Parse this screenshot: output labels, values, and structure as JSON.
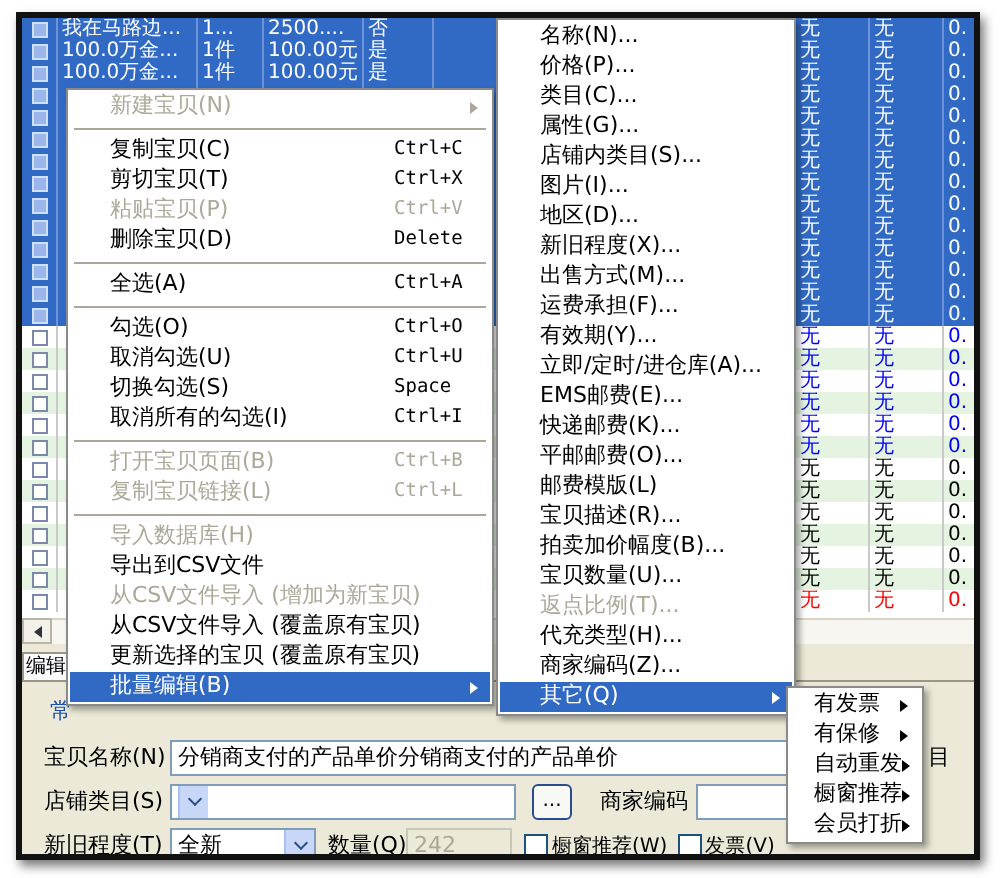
{
  "table": {
    "rows": [
      {
        "selected": true,
        "cells": [
          "我在马路边...",
          "1...",
          "2500....",
          "否"
        ],
        "end_cells": [
          "无",
          "无",
          "0."
        ]
      },
      {
        "selected": true,
        "cells": [
          "100.0万金...",
          "1件",
          "100.00元",
          "是"
        ],
        "end_cells": [
          "无",
          "无",
          "0."
        ]
      },
      {
        "selected": true,
        "cells": [
          "100.0万金...",
          "1件",
          "100.00元",
          "是"
        ],
        "end_cells": [
          "无",
          "无",
          "0."
        ]
      },
      {
        "selected": true,
        "end_cells": [
          "无",
          "无",
          "0."
        ]
      },
      {
        "selected": true,
        "end_cells": [
          "无",
          "无",
          "0."
        ]
      },
      {
        "selected": true,
        "end_cells": [
          "无",
          "无",
          "0."
        ]
      },
      {
        "selected": true,
        "end_cells": [
          "无",
          "无",
          "0."
        ]
      },
      {
        "selected": true,
        "end_cells": [
          "无",
          "无",
          "0."
        ]
      },
      {
        "selected": true,
        "end_cells": [
          "无",
          "无",
          "0."
        ]
      },
      {
        "selected": true,
        "end_cells": [
          "无",
          "无",
          "0."
        ]
      },
      {
        "selected": true,
        "end_cells": [
          "无",
          "无",
          "0."
        ]
      },
      {
        "selected": true,
        "end_cells": [
          "无",
          "无",
          "0."
        ]
      },
      {
        "selected": true,
        "end_cells": [
          "无",
          "无",
          "0."
        ]
      },
      {
        "selected": true,
        "end_cells": [
          "无",
          "无",
          "0."
        ]
      },
      {
        "selected": false,
        "color": "#0000ff",
        "end_cells": [
          "无",
          "无",
          "0."
        ]
      },
      {
        "selected": false,
        "color": "#0000ff",
        "end_cells": [
          "无",
          "无",
          "0."
        ]
      },
      {
        "selected": false,
        "color": "#0000ff",
        "end_cells": [
          "无",
          "无",
          "0."
        ]
      },
      {
        "selected": false,
        "color": "#0000ff",
        "end_cells": [
          "无",
          "无",
          "0."
        ]
      },
      {
        "selected": false,
        "color": "#0000ff",
        "end_cells": [
          "无",
          "无",
          "0."
        ]
      },
      {
        "selected": false,
        "color": "#0000ff",
        "end_cells": [
          "无",
          "无",
          "0."
        ]
      },
      {
        "selected": false,
        "color": "#000000",
        "end_cells": [
          "无",
          "无",
          "0."
        ]
      },
      {
        "selected": false,
        "color": "#000000",
        "end_cells": [
          "无",
          "无",
          "0."
        ]
      },
      {
        "selected": false,
        "color": "#000000",
        "end_cells": [
          "无",
          "无",
          "0."
        ]
      },
      {
        "selected": false,
        "color": "#000000",
        "end_cells": [
          "无",
          "无",
          "0."
        ]
      },
      {
        "selected": false,
        "color": "#000000",
        "end_cells": [
          "无",
          "无",
          "0."
        ]
      },
      {
        "selected": false,
        "color": "#000000",
        "end_cells": [
          "无",
          "无",
          "0."
        ]
      },
      {
        "selected": false,
        "color": "#ff0000",
        "end_cells": [
          "无",
          "无",
          "0."
        ]
      }
    ]
  },
  "context_menu": {
    "items": [
      {
        "kind": "item",
        "label": "新建宝贝(N)",
        "disabled": true,
        "has_submenu": true,
        "selected": false
      },
      {
        "kind": "separator"
      },
      {
        "kind": "item",
        "label": "复制宝贝(C)",
        "shortcut": "Ctrl+C",
        "disabled": false,
        "has_submenu": false,
        "selected": false
      },
      {
        "kind": "item",
        "label": "剪切宝贝(T)",
        "shortcut": "Ctrl+X",
        "disabled": false,
        "has_submenu": false,
        "selected": false
      },
      {
        "kind": "item",
        "label": "粘贴宝贝(P)",
        "shortcut": "Ctrl+V",
        "disabled": true,
        "has_submenu": false,
        "selected": false
      },
      {
        "kind": "item",
        "label": "删除宝贝(D)",
        "shortcut": "Delete",
        "disabled": false,
        "has_submenu": false,
        "selected": false
      },
      {
        "kind": "separator"
      },
      {
        "kind": "item",
        "label": "全选(A)",
        "shortcut": "Ctrl+A",
        "disabled": false,
        "has_submenu": false,
        "selected": false
      },
      {
        "kind": "separator"
      },
      {
        "kind": "item",
        "label": "勾选(O)",
        "shortcut": "Ctrl+O",
        "disabled": false,
        "has_submenu": false,
        "selected": false
      },
      {
        "kind": "item",
        "label": "取消勾选(U)",
        "shortcut": "Ctrl+U",
        "disabled": false,
        "has_submenu": false,
        "selected": false
      },
      {
        "kind": "item",
        "label": "切换勾选(S)",
        "shortcut": "Space",
        "disabled": false,
        "has_submenu": false,
        "selected": false
      },
      {
        "kind": "item",
        "label": "取消所有的勾选(I)",
        "shortcut": "Ctrl+I",
        "disabled": false,
        "has_submenu": false,
        "selected": false
      },
      {
        "kind": "separator"
      },
      {
        "kind": "item",
        "label": "打开宝贝页面(B)",
        "shortcut": "Ctrl+B",
        "disabled": true,
        "has_submenu": false,
        "selected": false
      },
      {
        "kind": "item",
        "label": "复制宝贝链接(L)",
        "shortcut": "Ctrl+L",
        "disabled": true,
        "has_submenu": false,
        "selected": false
      },
      {
        "kind": "separator"
      },
      {
        "kind": "item",
        "label": "导入数据库(H)",
        "disabled": true,
        "has_submenu": false,
        "selected": false
      },
      {
        "kind": "item",
        "label": "导出到CSV文件",
        "disabled": false,
        "has_submenu": false,
        "selected": false
      },
      {
        "kind": "item",
        "label": "从CSV文件导入 (增加为新宝贝)",
        "disabled": true,
        "has_submenu": false,
        "selected": false
      },
      {
        "kind": "item",
        "label": "从CSV文件导入 (覆盖原有宝贝)",
        "disabled": false,
        "has_submenu": false,
        "selected": false
      },
      {
        "kind": "item",
        "label": "更新选择的宝贝 (覆盖原有宝贝)",
        "disabled": false,
        "has_submenu": false,
        "selected": false
      },
      {
        "kind": "item",
        "label": "批量编辑(B)",
        "disabled": false,
        "has_submenu": true,
        "selected": true
      }
    ]
  },
  "batch_edit_menu": {
    "items": [
      {
        "kind": "item",
        "label": "名称(N)...",
        "disabled": false,
        "has_submenu": false,
        "selected": false
      },
      {
        "kind": "item",
        "label": "价格(P)...",
        "disabled": false,
        "has_submenu": false,
        "selected": false
      },
      {
        "kind": "item",
        "label": "类目(C)...",
        "disabled": false,
        "has_submenu": false,
        "selected": false
      },
      {
        "kind": "item",
        "label": "属性(G)...",
        "disabled": false,
        "has_submenu": false,
        "selected": false
      },
      {
        "kind": "item",
        "label": "店铺内类目(S)...",
        "disabled": false,
        "has_submenu": false,
        "selected": false
      },
      {
        "kind": "item",
        "label": "图片(I)...",
        "disabled": false,
        "has_submenu": false,
        "selected": false
      },
      {
        "kind": "item",
        "label": "地区(D)...",
        "disabled": false,
        "has_submenu": false,
        "selected": false
      },
      {
        "kind": "item",
        "label": "新旧程度(X)...",
        "disabled": false,
        "has_submenu": false,
        "selected": false
      },
      {
        "kind": "item",
        "label": "出售方式(M)...",
        "disabled": false,
        "has_submenu": false,
        "selected": false
      },
      {
        "kind": "item",
        "label": "运费承担(F)...",
        "disabled": false,
        "has_submenu": false,
        "selected": false
      },
      {
        "kind": "item",
        "label": "有效期(Y)...",
        "disabled": false,
        "has_submenu": false,
        "selected": false
      },
      {
        "kind": "item",
        "label": "立即/定时/进仓库(A)...",
        "disabled": false,
        "has_submenu": false,
        "selected": false
      },
      {
        "kind": "item",
        "label": "EMS邮费(E)...",
        "disabled": false,
        "has_submenu": false,
        "selected": false
      },
      {
        "kind": "item",
        "label": "快递邮费(K)...",
        "disabled": false,
        "has_submenu": false,
        "selected": false
      },
      {
        "kind": "item",
        "label": "平邮邮费(O)...",
        "disabled": false,
        "has_submenu": false,
        "selected": false
      },
      {
        "kind": "item",
        "label": "邮费模版(L)",
        "disabled": false,
        "has_submenu": false,
        "selected": false
      },
      {
        "kind": "item",
        "label": "宝贝描述(R)...",
        "disabled": false,
        "has_submenu": false,
        "selected": false
      },
      {
        "kind": "item",
        "label": "拍卖加价幅度(B)...",
        "disabled": false,
        "has_submenu": false,
        "selected": false
      },
      {
        "kind": "item",
        "label": "宝贝数量(U)...",
        "disabled": false,
        "has_submenu": false,
        "selected": false
      },
      {
        "kind": "item",
        "label": "返点比例(T)...",
        "disabled": true,
        "has_submenu": false,
        "selected": false
      },
      {
        "kind": "item",
        "label": "代充类型(H)...",
        "disabled": false,
        "has_submenu": false,
        "selected": false
      },
      {
        "kind": "item",
        "label": "商家编码(Z)...",
        "disabled": false,
        "has_submenu": false,
        "selected": false
      },
      {
        "kind": "item",
        "label": "其它(Q)",
        "disabled": false,
        "has_submenu": true,
        "selected": true
      }
    ]
  },
  "other_menu": {
    "items": [
      {
        "kind": "item",
        "label": "有发票",
        "has_submenu": true,
        "selected": false
      },
      {
        "kind": "item",
        "label": "有保修",
        "has_submenu": true,
        "selected": false
      },
      {
        "kind": "item",
        "label": "自动重发",
        "has_submenu": true,
        "selected": false
      },
      {
        "kind": "item",
        "label": "橱窗推荐",
        "has_submenu": true,
        "selected": false
      },
      {
        "kind": "item",
        "label": "会员打折",
        "has_submenu": true,
        "selected": false
      }
    ]
  },
  "bottom_panel": {
    "tab": "编辑",
    "group_label": "常",
    "name_label": "宝贝名称(N)",
    "name_value": "分销商支付的产品单价分销商支付的产品单价",
    "side_label": "目",
    "category_label": "店铺类目(S)",
    "browse_button": "...",
    "merchant_code_label": "商家编码",
    "condition_label": "新旧程度(T)",
    "condition_value": "全新",
    "quantity_label": "数量(Q)",
    "quantity": {
      "value": "242",
      "disabled": true
    },
    "checkboxes": [
      {
        "label": "橱窗推荐(W)",
        "checked": false
      },
      {
        "label": "发票(V)",
        "checked": false
      }
    ]
  }
}
